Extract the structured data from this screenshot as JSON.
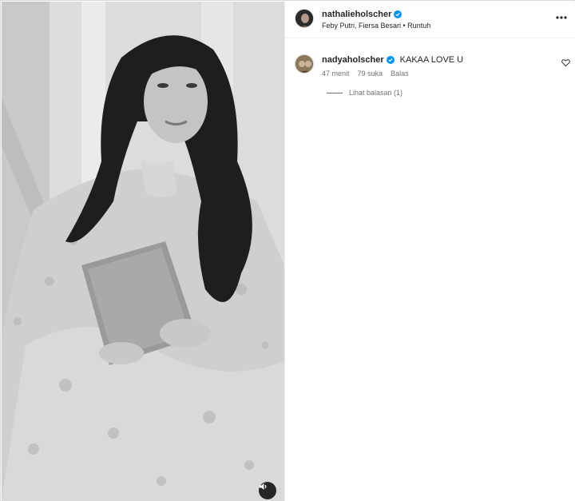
{
  "post": {
    "username": "nathalieholscher",
    "audio": "Feby Putri, Fiersa Besari • Runtuh",
    "verified": true
  },
  "comment": {
    "username": "nadyaholscher",
    "verified": true,
    "text": "KAKAA LOVE U",
    "time": "47 menit",
    "likes": "79 suka",
    "reply_label": "Balas",
    "view_replies": "Lihat balasan (1)"
  },
  "colors": {
    "verified_badge": "#0095f6",
    "text_primary": "#262626",
    "text_secondary": "#737373"
  },
  "icons": [
    "more-horizontal-icon",
    "heart-icon",
    "sound-icon",
    "verified-badge-icon"
  ]
}
